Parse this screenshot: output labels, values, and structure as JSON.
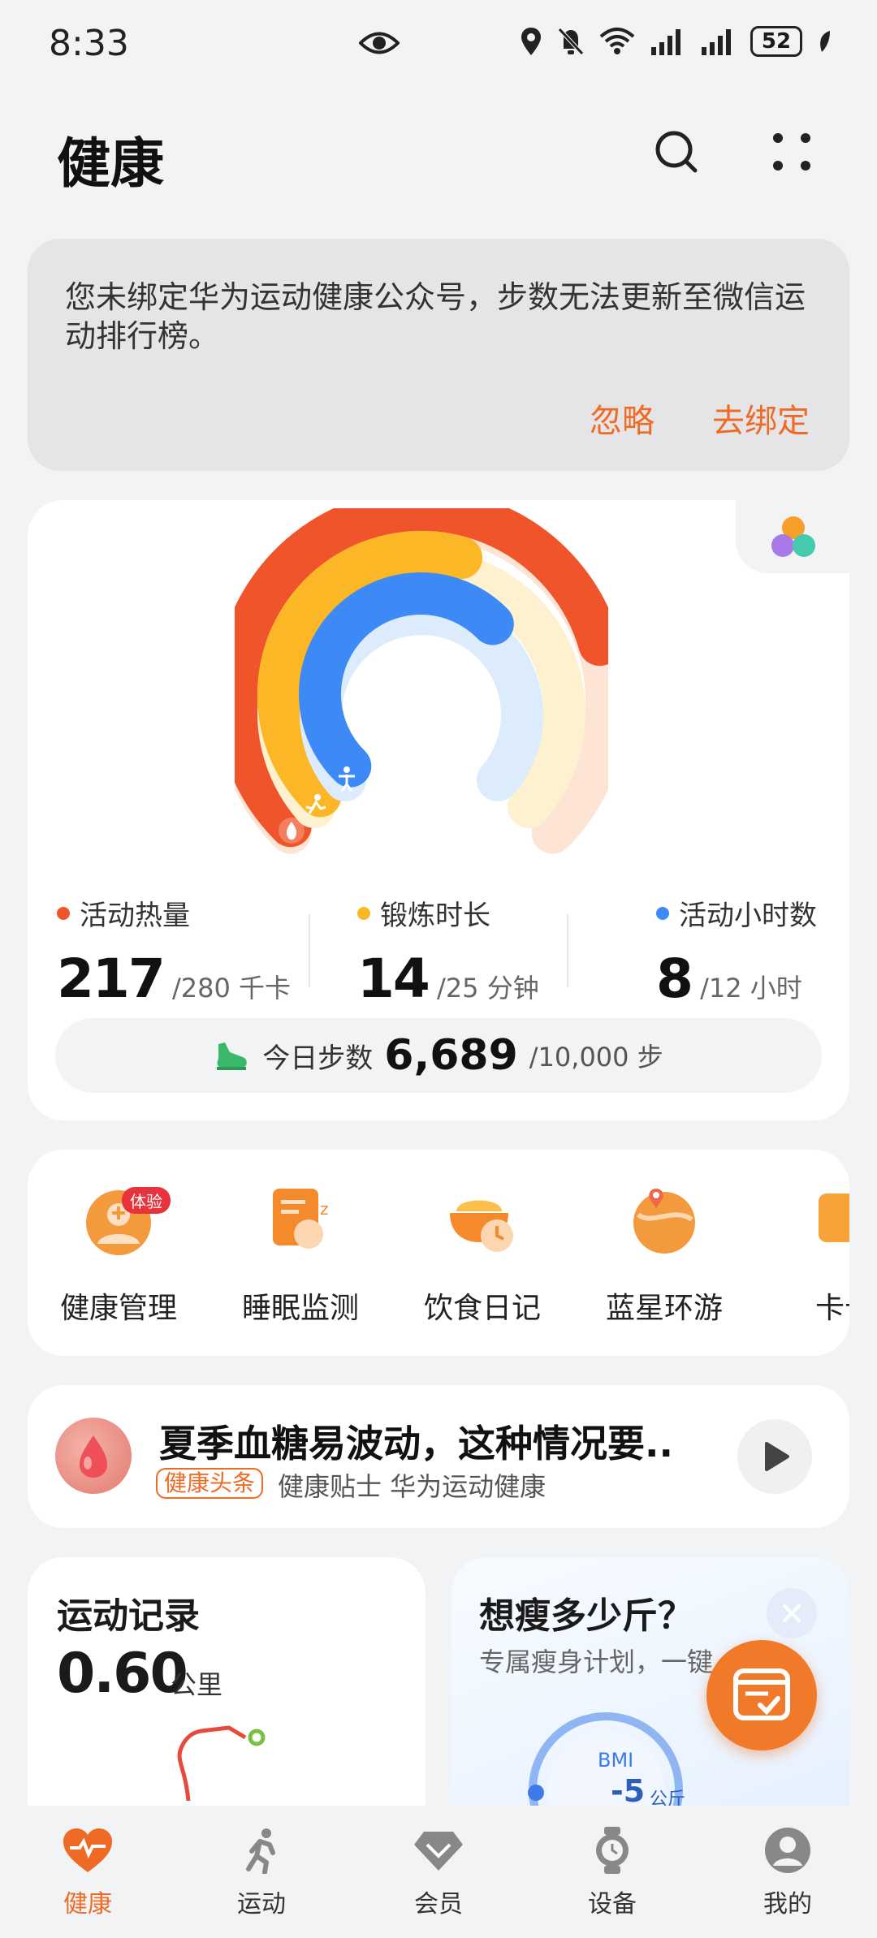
{
  "status": {
    "time": "8:33",
    "battery": "52"
  },
  "header": {
    "title": "健康"
  },
  "banner": {
    "text": "您未绑定华为运动健康公众号，步数无法更新至微信运动排行榜。",
    "ignore": "忽略",
    "bind": "去绑定"
  },
  "activity": {
    "calories": {
      "label": "活动热量",
      "value": "217",
      "goal": "/280 千卡",
      "progress": 0.775,
      "color": "#f0542a"
    },
    "exercise": {
      "label": "锻炼时长",
      "value": "14",
      "goal": "/25 分钟",
      "progress": 0.56,
      "color": "#fbb725"
    },
    "hours": {
      "label": "活动小时数",
      "value": "8",
      "goal": "/12 小时",
      "progress": 0.667,
      "color": "#3d8af7"
    },
    "steps": {
      "label": "今日步数",
      "value": "6,689",
      "goal": "/10,000 步"
    }
  },
  "services": [
    {
      "label": "健康管理",
      "badge": "体验"
    },
    {
      "label": "睡眠监测"
    },
    {
      "label": "饮食日记"
    },
    {
      "label": "蓝星环游"
    },
    {
      "label": "卡卡"
    }
  ],
  "news": {
    "title": "夏季血糖易波动，这种情况要..",
    "tag": "健康头条",
    "meta": "健康贴士 华为运动健康"
  },
  "sport_record": {
    "title": "运动记录",
    "value": "0.60",
    "unit": "公里"
  },
  "plan": {
    "title": "想瘦多少斤？",
    "subtitle": "专属瘦身计划，一键",
    "bmi_label": "BMI",
    "bmi_value": "-5",
    "bmi_unit": "公斤"
  },
  "nav": [
    {
      "label": "健康",
      "active": true
    },
    {
      "label": "运动"
    },
    {
      "label": "会员"
    },
    {
      "label": "设备"
    },
    {
      "label": "我的"
    }
  ]
}
